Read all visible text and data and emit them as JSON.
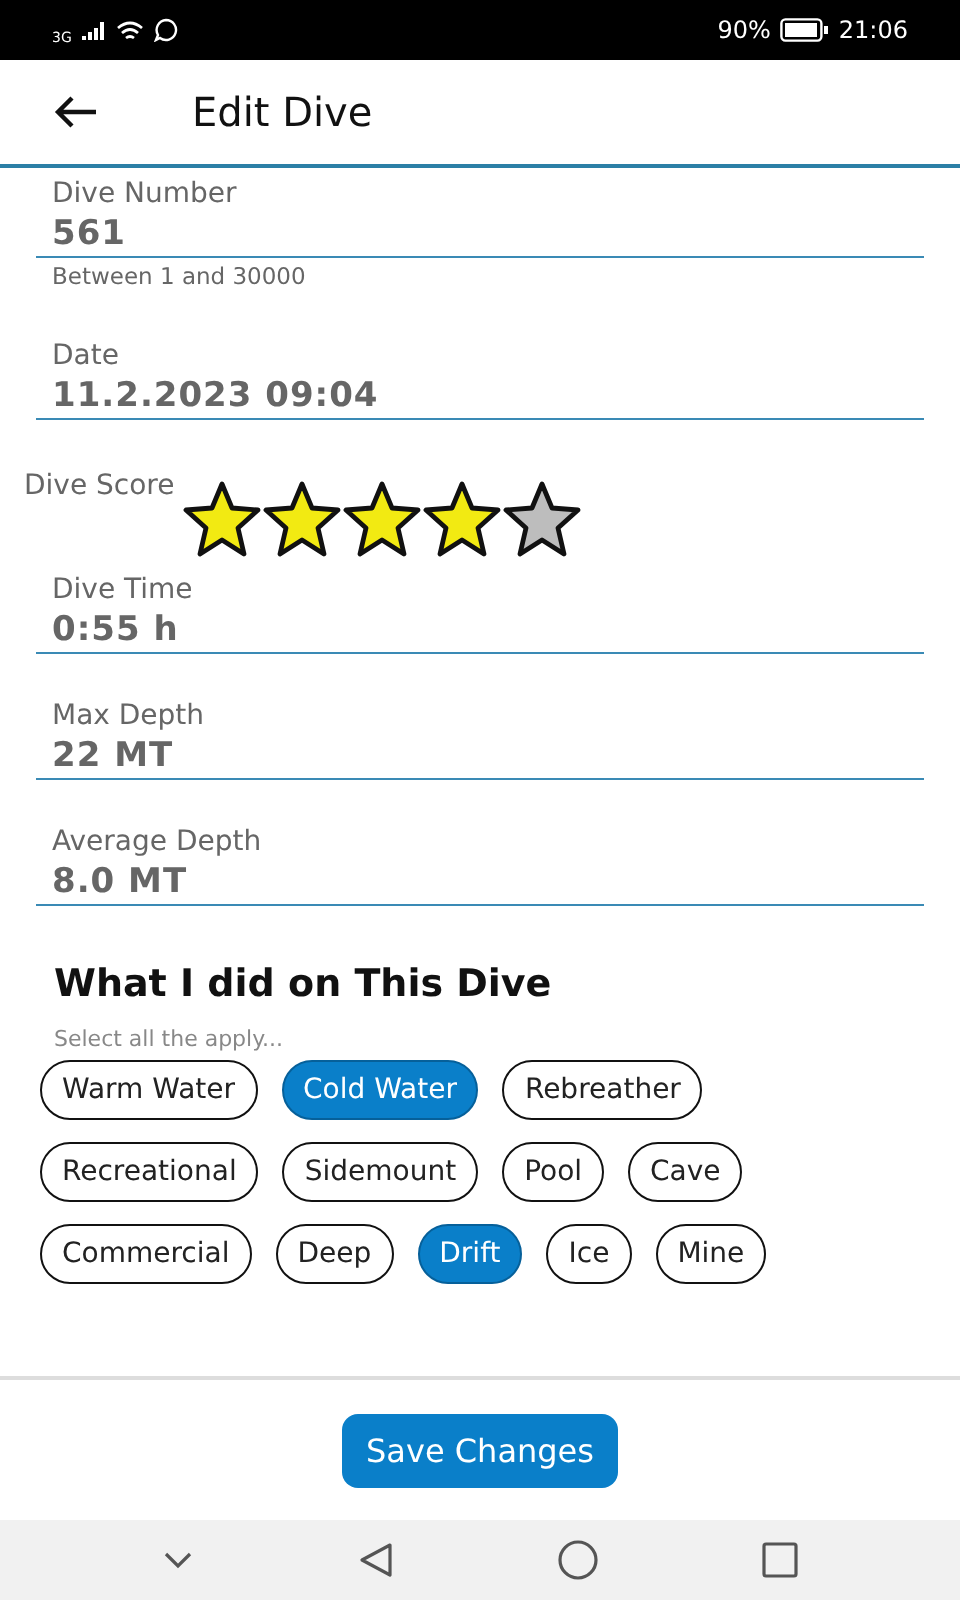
{
  "status_bar": {
    "network": "3G",
    "battery": "90%",
    "time": "21:06"
  },
  "header": {
    "title": "Edit Dive"
  },
  "fields": [
    {
      "kind": "text",
      "label": "Dive Number",
      "value": "561",
      "hint": "Between 1 and 30000"
    },
    {
      "kind": "text",
      "label": "Date",
      "value": "11.2.2023 09:04"
    },
    {
      "kind": "stars",
      "label": "Dive Score",
      "stars": 4
    },
    {
      "kind": "text",
      "label": "Dive Time",
      "value": "0:55 h"
    },
    {
      "kind": "text",
      "label": "Max Depth",
      "value": "22 MT"
    },
    {
      "kind": "text",
      "label": "Average Depth",
      "value": "8.0 MT"
    }
  ],
  "activities": {
    "title": "What I did on This Dive",
    "hint": "Select all the apply...",
    "chip_rows": [
      [
        {
          "label": "Warm Water",
          "selected": false
        },
        {
          "label": "Cold Water",
          "selected": true
        },
        {
          "label": "Rebreather",
          "selected": false
        }
      ],
      [
        {
          "label": "Recreational",
          "selected": false
        },
        {
          "label": "Sidemount",
          "selected": false
        },
        {
          "label": "Pool",
          "selected": false
        },
        {
          "label": "Cave",
          "selected": false
        }
      ],
      [
        {
          "label": "Commercial",
          "selected": false
        },
        {
          "label": "Deep",
          "selected": false
        },
        {
          "label": "Drift",
          "selected": true
        },
        {
          "label": "Ice",
          "selected": false
        },
        {
          "label": "Mine",
          "selected": false
        }
      ]
    ]
  },
  "save_button": "Save Changes"
}
